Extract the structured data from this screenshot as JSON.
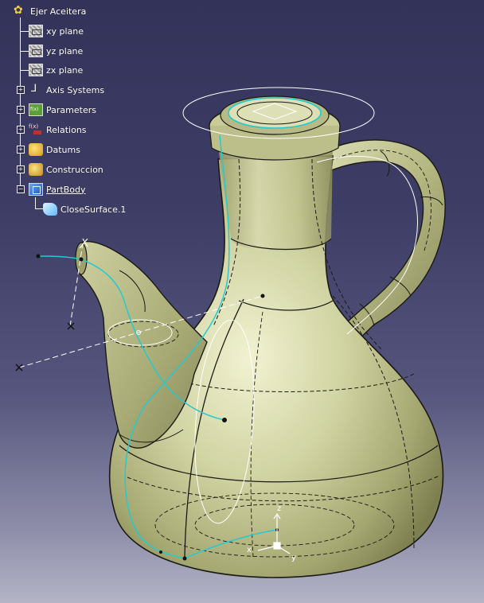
{
  "spec_tree": {
    "root_label": "Ejer Aceitera",
    "nodes": [
      {
        "id": "xy",
        "label": "xy plane",
        "icon": "plane-icon"
      },
      {
        "id": "yz",
        "label": "yz plane",
        "icon": "plane-icon"
      },
      {
        "id": "zx",
        "label": "zx plane",
        "icon": "plane-icon"
      },
      {
        "id": "axis",
        "label": "Axis Systems",
        "icon": "axis-system-icon",
        "expander": "+"
      },
      {
        "id": "params",
        "label": "Parameters",
        "icon": "parameters-icon",
        "expander": "+"
      },
      {
        "id": "rel",
        "label": "Relations",
        "icon": "relations-icon",
        "expander": "+"
      },
      {
        "id": "datums",
        "label": "Datums",
        "icon": "datums-icon",
        "expander": "+"
      },
      {
        "id": "constr",
        "label": "Construccion",
        "icon": "construction-icon",
        "expander": "+"
      },
      {
        "id": "partbody",
        "label": "PartBody",
        "icon": "partbody-icon",
        "expander": "−"
      },
      {
        "id": "surface",
        "label": "CloseSurface.1",
        "icon": "close-surface-icon"
      }
    ]
  },
  "compass": {
    "x_label": "x",
    "y_label": "y",
    "z_label": "z"
  },
  "colors": {
    "background_top": "#33335a",
    "background_bottom": "#b4b4c6",
    "solid_fill": "#c4c690",
    "edge": "#1a1a14",
    "curve": "#26c9cf",
    "construction": "#ffffff"
  }
}
